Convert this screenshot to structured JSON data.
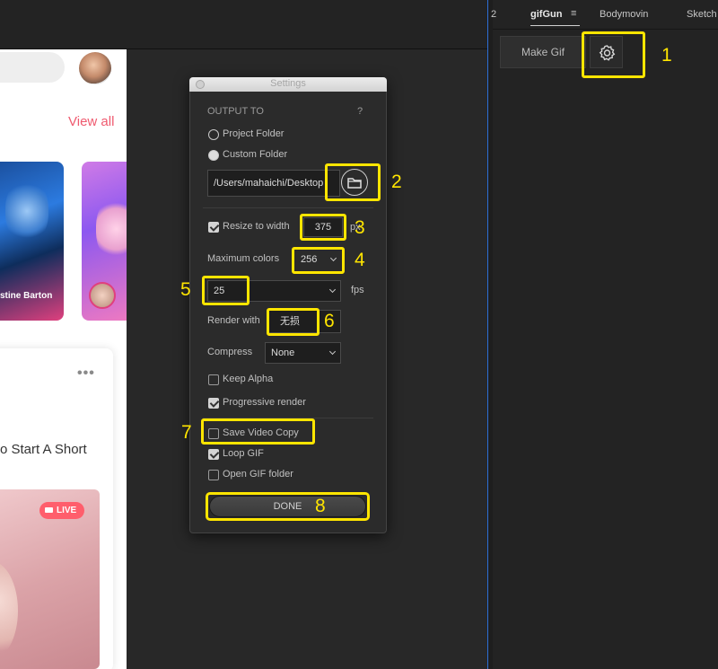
{
  "host": {
    "feed": {
      "view_all": "View all",
      "story_name": "stine Barton",
      "post_more": "•••",
      "post_text": "o Start A Short",
      "live_badge": "LIVE"
    }
  },
  "panel": {
    "tabs": [
      {
        "label": "2"
      },
      {
        "label": "gifGun",
        "active": true
      },
      {
        "label": "≡"
      },
      {
        "label": "Bodymovin"
      },
      {
        "label": "Sketch"
      }
    ],
    "make_gif_label": "Make Gif",
    "settings_icon": "gear-icon"
  },
  "dialog": {
    "title": "Settings",
    "output_to": "OUTPUT TO",
    "help": "?",
    "project_folder": "Project Folder",
    "custom_folder": "Custom Folder",
    "path_value": "/Users/mahaichi/Desktop",
    "folder_icon": "folder-icon",
    "resize_label": "Resize to width",
    "resize_value": "375",
    "resize_unit": "px",
    "max_colors_label": "Maximum colors",
    "max_colors_value": "256",
    "fps_value": "25",
    "fps_unit": "fps",
    "render_label": "Render with",
    "render_value": "无损",
    "compress_label": "Compress",
    "compress_value": "None",
    "keep_alpha": "Keep Alpha",
    "progressive_render": "Progressive render",
    "save_video_copy": "Save Video Copy",
    "loop_gif": "Loop GIF",
    "open_gif_folder": "Open GIF folder",
    "done_label": "DONE",
    "checks": {
      "resize": true,
      "keep_alpha": false,
      "progressive": true,
      "save_video": false,
      "loop": true,
      "open_folder": false
    },
    "output_selected": "custom"
  },
  "annotations": {
    "n1": "1",
    "n2": "2",
    "n3": "3",
    "n4": "4",
    "n5": "5",
    "n6": "6",
    "n7": "7",
    "n8": "8",
    "color": "#ffe500"
  }
}
